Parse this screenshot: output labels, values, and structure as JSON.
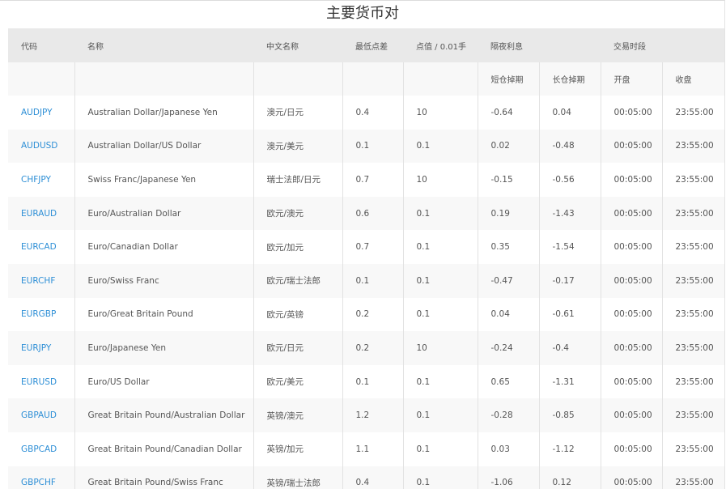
{
  "title": "主要货币对",
  "headers": {
    "code": "代码",
    "name": "名称",
    "cn_name": "中文名称",
    "min_spread": "最低点差",
    "point_value": "点值 / 0.01手",
    "overnight": "隔夜利息",
    "trading_hours": "交易时段",
    "short_swap": "短仓掉期",
    "long_swap": "长仓掉期",
    "open": "开盘",
    "close": "收盘"
  },
  "rows": [
    {
      "code": "AUDJPY",
      "name": "Australian Dollar/Japanese Yen",
      "cn": "澳元/日元",
      "spread": "0.4",
      "point": "10",
      "short": "-0.64",
      "long": "0.04",
      "open": "00:05:00",
      "close": "23:55:00"
    },
    {
      "code": "AUDUSD",
      "name": "Australian Dollar/US Dollar",
      "cn": "澳元/美元",
      "spread": "0.1",
      "point": "0.1",
      "short": "0.02",
      "long": "-0.48",
      "open": "00:05:00",
      "close": "23:55:00"
    },
    {
      "code": "CHFJPY",
      "name": "Swiss Franc/Japanese Yen",
      "cn": "瑞士法郎/日元",
      "spread": "0.7",
      "point": "10",
      "short": "-0.15",
      "long": "-0.56",
      "open": "00:05:00",
      "close": "23:55:00"
    },
    {
      "code": "EURAUD",
      "name": "Euro/Australian Dollar",
      "cn": "欧元/澳元",
      "spread": "0.6",
      "point": "0.1",
      "short": "0.19",
      "long": "-1.43",
      "open": "00:05:00",
      "close": "23:55:00"
    },
    {
      "code": "EURCAD",
      "name": "Euro/Canadian Dollar",
      "cn": "欧元/加元",
      "spread": "0.7",
      "point": "0.1",
      "short": "0.35",
      "long": "-1.54",
      "open": "00:05:00",
      "close": "23:55:00"
    },
    {
      "code": "EURCHF",
      "name": "Euro/Swiss Franc",
      "cn": "欧元/瑞士法郎",
      "spread": "0.1",
      "point": "0.1",
      "short": "-0.47",
      "long": "-0.17",
      "open": "00:05:00",
      "close": "23:55:00"
    },
    {
      "code": "EURGBP",
      "name": "Euro/Great Britain Pound",
      "cn": "欧元/英镑",
      "spread": "0.2",
      "point": "0.1",
      "short": "0.04",
      "long": "-0.61",
      "open": "00:05:00",
      "close": "23:55:00"
    },
    {
      "code": "EURJPY",
      "name": "Euro/Japanese Yen",
      "cn": "欧元/日元",
      "spread": "0.2",
      "point": "10",
      "short": "-0.24",
      "long": "-0.4",
      "open": "00:05:00",
      "close": "23:55:00"
    },
    {
      "code": "EURUSD",
      "name": "Euro/US Dollar",
      "cn": "欧元/美元",
      "spread": "0.1",
      "point": "0.1",
      "short": "0.65",
      "long": "-1.31",
      "open": "00:05:00",
      "close": "23:55:00"
    },
    {
      "code": "GBPAUD",
      "name": "Great Britain Pound/Australian Dollar",
      "cn": "英镑/澳元",
      "spread": "1.2",
      "point": "0.1",
      "short": "-0.28",
      "long": "-0.85",
      "open": "00:05:00",
      "close": "23:55:00"
    },
    {
      "code": "GBPCAD",
      "name": "Great Britain Pound/Canadian Dollar",
      "cn": "英镑/加元",
      "spread": "1.1",
      "point": "0.1",
      "short": "0.03",
      "long": "-1.12",
      "open": "00:05:00",
      "close": "23:55:00"
    },
    {
      "code": "GBPCHF",
      "name": "Great Britain Pound/Swiss Franc",
      "cn": "英镑/瑞士法郎",
      "spread": "0.4",
      "point": "0.1",
      "short": "-1.06",
      "long": "0.12",
      "open": "00:05:00",
      "close": "23:55:00"
    }
  ],
  "colors": {
    "link": "#2e8fd6",
    "header_bg": "#e9e9e9",
    "stripe_bg": "#f8f8f8"
  }
}
